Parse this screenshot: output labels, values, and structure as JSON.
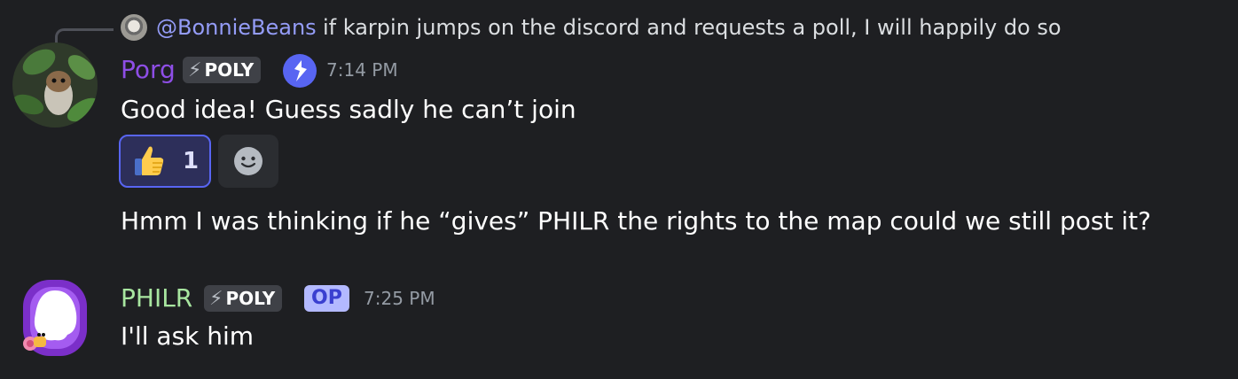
{
  "reply": {
    "username": "@BonnieBeans",
    "text": "if karpin jumps on the discord and requests a poll, I will happily do so"
  },
  "messages": [
    {
      "author": "Porg",
      "author_color": "#8e4ee6",
      "tag": "POLY",
      "time": "7:14 PM",
      "lines": [
        "Good idea! Guess sadly he can’t join",
        "Hmm I was thinking if he “gives” PHILR the rights to the map could we still post it?"
      ],
      "reaction": {
        "emoji": "thumbs-up",
        "count": "1"
      }
    },
    {
      "author": "PHILR",
      "author_color": "#a8e6a0",
      "tag": "POLY",
      "badge": "OP",
      "time": "7:25 PM",
      "lines": [
        "I'll ask him"
      ]
    }
  ],
  "colors": {
    "background": "#1e1f22",
    "mention": "#949cf7",
    "reaction_border": "#5865f2"
  }
}
